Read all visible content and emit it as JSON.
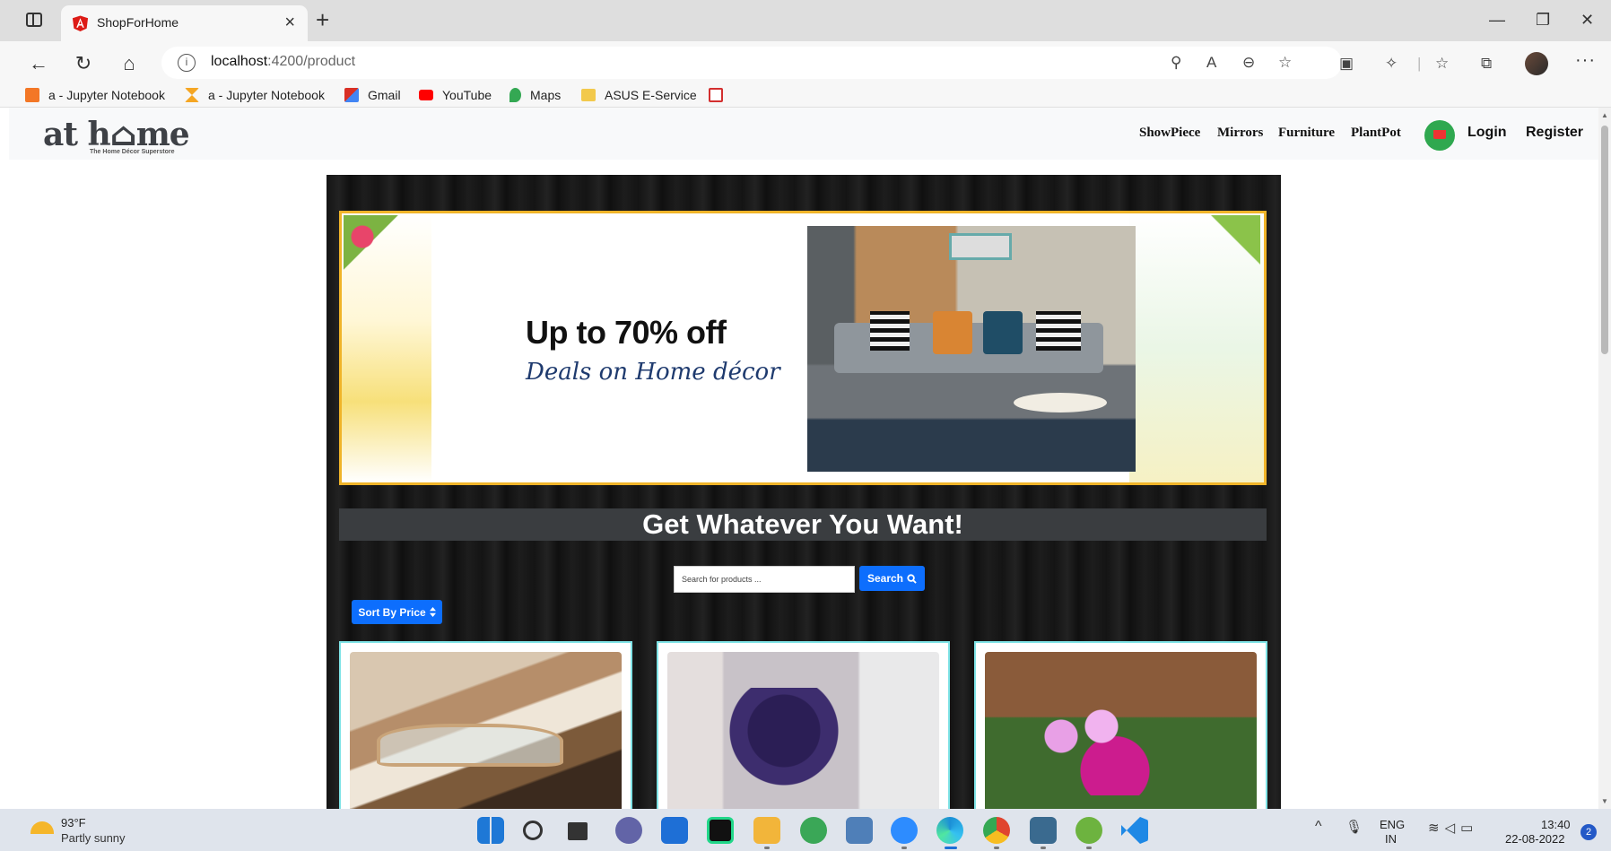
{
  "browser": {
    "tab_title": "ShopForHome",
    "tab_close": "×",
    "new_tab": "+",
    "url_host": "localhost",
    "url_path": ":4200/product",
    "info_glyph": "i",
    "window_controls": {
      "minimize": "—",
      "maximize": "❐",
      "close": "✕"
    },
    "nav_glyphs": {
      "back": "←",
      "reload": "↻",
      "home": "⌂"
    },
    "toolbar_glyphs": [
      "⚲",
      "A",
      "⊖",
      "☆",
      "▣",
      "✧",
      "|",
      "☆",
      "⧉"
    ],
    "more": "···",
    "bookmarks": [
      {
        "label": "a - Jupyter Notebook",
        "icon": "notebook-icon",
        "color": "#f37726"
      },
      {
        "label": "a - Jupyter Notebook",
        "icon": "hourglass-icon",
        "color": "#f5a623"
      },
      {
        "label": "Gmail",
        "icon": "gmail-icon",
        "color": "#d93025"
      },
      {
        "label": "YouTube",
        "icon": "youtube-icon",
        "color": "#ff0000"
      },
      {
        "label": "Maps",
        "icon": "maps-icon",
        "color": "#34a853"
      },
      {
        "label": "ASUS E-Service",
        "icon": "folder-icon",
        "color": "#f2c94c"
      },
      {
        "label": "",
        "icon": "pdf-icon",
        "color": "#d32f2f"
      }
    ]
  },
  "site": {
    "logo_text": "at h⌂me",
    "logo_tagline": "The Home Décor Superstore",
    "nav_links": [
      "ShowPiece",
      "Mirrors",
      "Furniture",
      "PlantPot"
    ],
    "login": "Login",
    "register": "Register",
    "banner": {
      "headline": "Up to 70% off",
      "subline": "Deals on Home décor"
    },
    "tagline": "Get Whatever You Want!",
    "search": {
      "placeholder": "Search for products ...",
      "button": "Search"
    },
    "sort_button": "Sort By Price",
    "products": [
      {
        "image": "glass-coffee-table"
      },
      {
        "image": "bonsai-showpiece"
      },
      {
        "image": "flower-plant-pot"
      }
    ],
    "colors": {
      "primary": "#0d6efd",
      "card_border": "#7fe3e6",
      "banner_border": "#f0b429",
      "cart": "#2fa84f"
    }
  },
  "taskbar": {
    "weather_temp": "93°F",
    "weather_desc": "Partly sunny",
    "apps": [
      {
        "name": "start",
        "color": "#1e78d6"
      },
      {
        "name": "search",
        "color": "#333333"
      },
      {
        "name": "task-view",
        "color": "#333333"
      },
      {
        "name": "teams-chat",
        "color": "#6264a7"
      },
      {
        "name": "mail",
        "color": "#1e6fd6"
      },
      {
        "name": "pycharm",
        "color": "#111111"
      },
      {
        "name": "file-explorer",
        "color": "#f2b53a"
      },
      {
        "name": "maps",
        "color": "#3aa757"
      },
      {
        "name": "photos",
        "color": "#4f7fb8"
      },
      {
        "name": "zoom",
        "color": "#2d8cff"
      },
      {
        "name": "edge",
        "color": "#1b8fd6"
      },
      {
        "name": "chrome",
        "color": "#e0452f"
      },
      {
        "name": "mysql-workbench",
        "color": "#3a6a8f"
      },
      {
        "name": "spring-tool-suite",
        "color": "#6db33f"
      },
      {
        "name": "vscode",
        "color": "#1e88e5"
      }
    ],
    "lang_1": "ENG",
    "lang_2": "IN",
    "time": "13:40",
    "date": "22-08-2022",
    "notifications": "2"
  }
}
